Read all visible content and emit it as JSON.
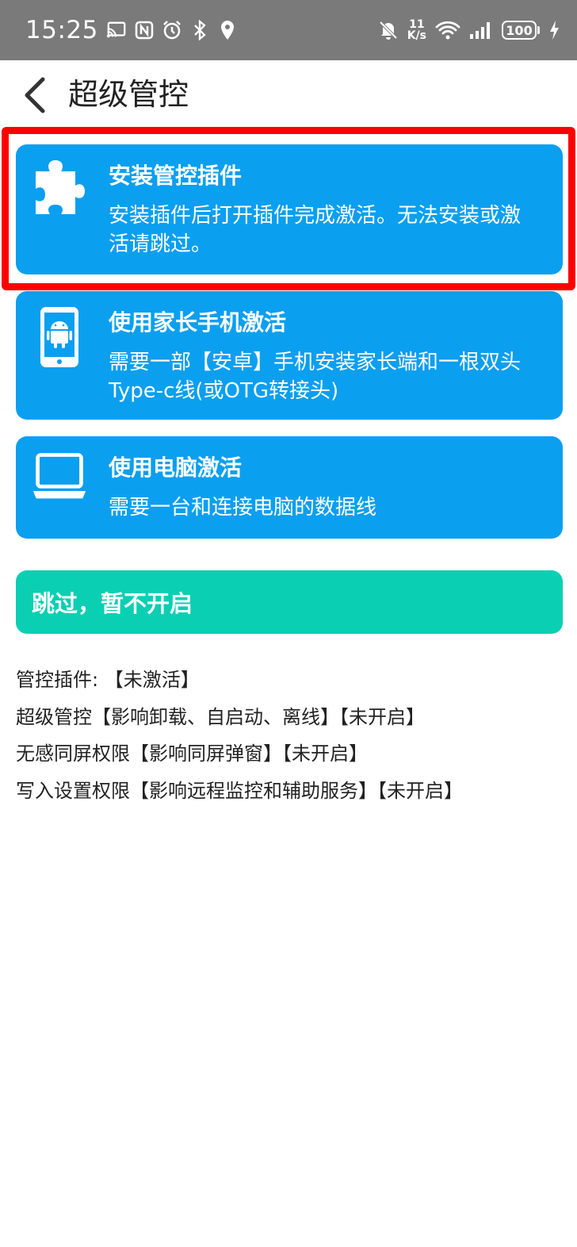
{
  "status_bar": {
    "time": "15:25",
    "net_speed_value": "11",
    "net_speed_unit": "K/s",
    "battery": "100",
    "left_icons": [
      "cast-icon",
      "nfc-icon",
      "alarm-icon",
      "bluetooth-icon",
      "location-icon"
    ],
    "right_icons": [
      "mute-bell-icon",
      "wifi-icon",
      "signal-icon",
      "charging-icon"
    ]
  },
  "header": {
    "back_icon": "chevron-left-icon",
    "title": "超级管控"
  },
  "options": [
    {
      "icon": "puzzle-icon",
      "title": "安装管控插件",
      "description": "安装插件后打开插件完成激活。无法安装或激活请跳过。"
    },
    {
      "icon": "android-phone-icon",
      "title": "使用家长手机激活",
      "description": "需要一部【安卓】手机安装家长端和一根双头Type-c线(或OTG转接头)"
    },
    {
      "icon": "laptop-icon",
      "title": "使用电脑激活",
      "description": "需要一台和连接电脑的数据线"
    }
  ],
  "skip_button": "跳过，暂不开启",
  "status_lines": [
    "管控插件: 【未激活】",
    "超级管控【影响卸载、自启动、离线】【未开启】",
    "无感同屏权限【影响同屏弹窗】【未开启】",
    "写入设置权限【影响远程监控和辅助服务】【未开启】"
  ],
  "colors": {
    "status_bar": "#7a7a7a",
    "card_blue": "#0b9ff0",
    "skip_green": "#0bcfb3",
    "highlight_red": "#ff0000"
  }
}
